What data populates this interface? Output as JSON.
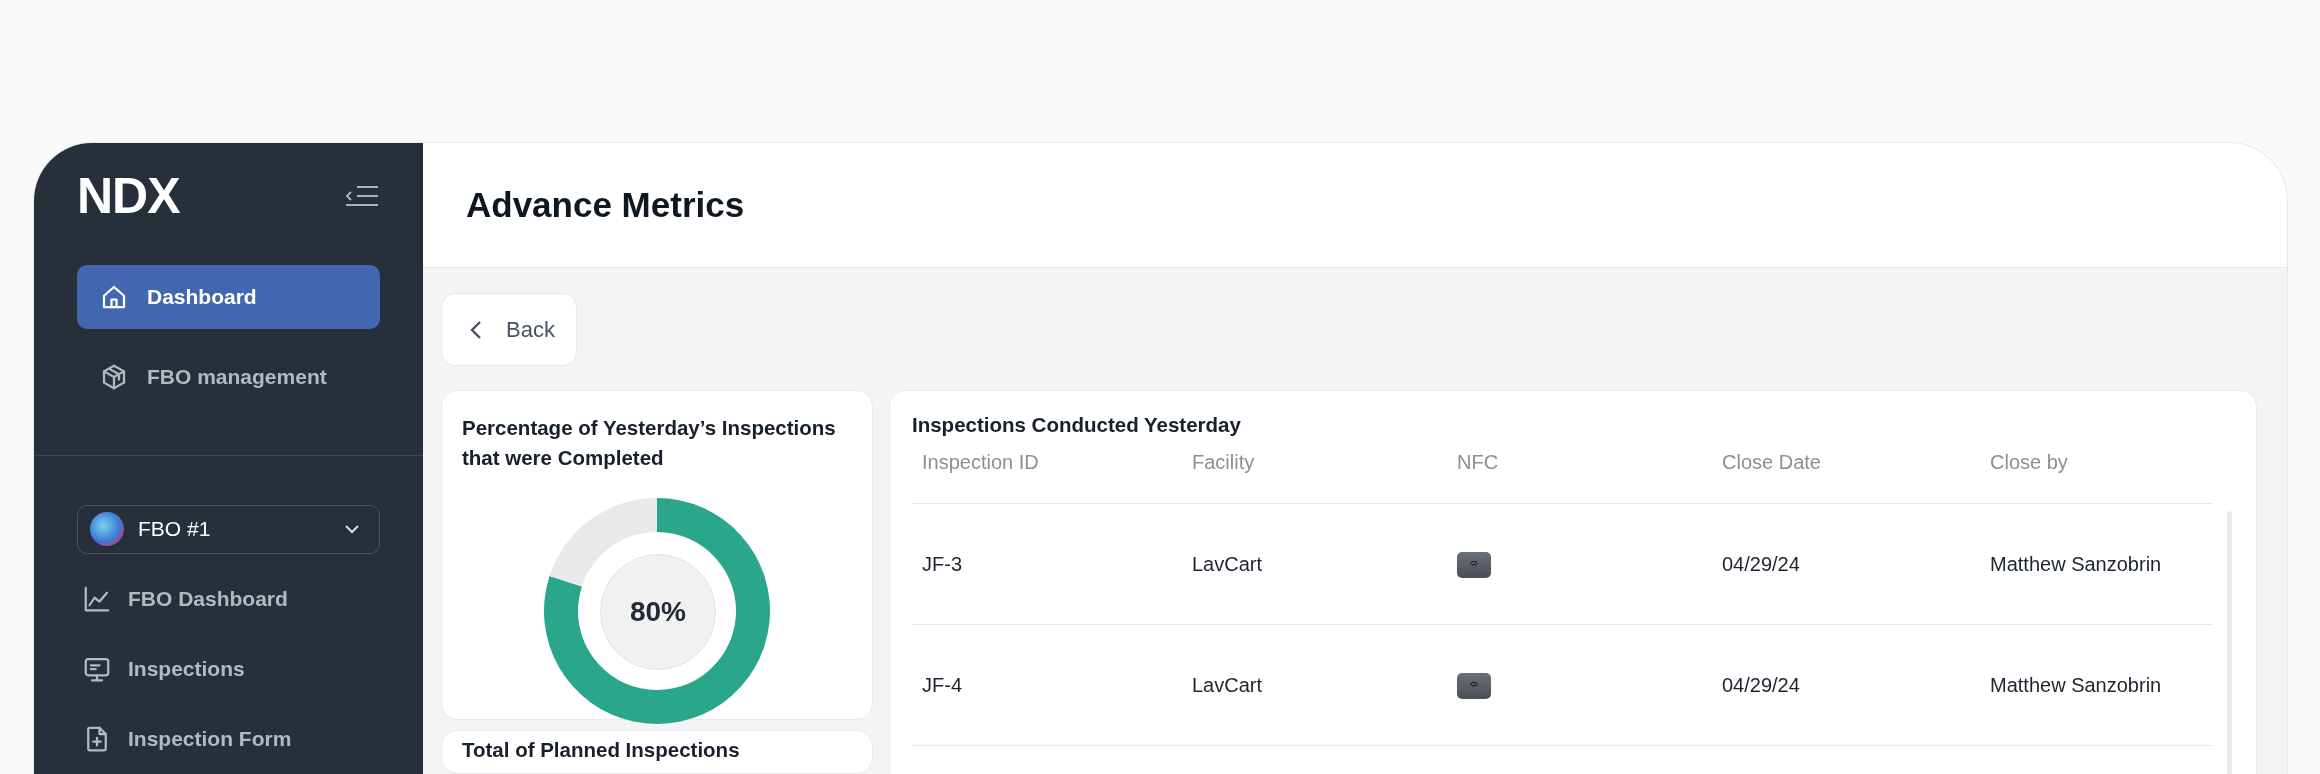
{
  "sidebar": {
    "logo": "NDX",
    "nav": [
      {
        "label": "Dashboard",
        "selected": true
      },
      {
        "label": "FBO management",
        "selected": false
      }
    ],
    "fbo_select": {
      "value": "FBO #1"
    },
    "fbo_nav": [
      {
        "label": "FBO Dashboard",
        "selected": false
      },
      {
        "label": "Inspections",
        "selected": false
      },
      {
        "label": "Inspection Form",
        "selected": false
      }
    ]
  },
  "header": {
    "title": "Advance Metrics"
  },
  "back_button": "Back",
  "completion_card": {
    "title": "Percentage of Yesterday’s Inspections that were Completed",
    "chart_data": {
      "type": "donut",
      "values": [
        80,
        20
      ]
    },
    "reading": "80%"
  },
  "planned_card": {
    "title": "Total of Planned Inspections"
  },
  "table": {
    "title": "Inspections Conducted Yesterday",
    "columns": [
      "Inspection ID",
      "Facility",
      "NFC",
      "Close Date",
      "Close by"
    ],
    "rows": [
      {
        "inspection_id": "JF-3",
        "facility": "LavCart",
        "close_date": "04/29/24",
        "close_by": "Matthew Sanzobrin"
      },
      {
        "inspection_id": "JF-4",
        "facility": "LavCart",
        "close_date": "04/29/24",
        "close_by": "Matthew Sanzobrin"
      }
    ]
  }
}
